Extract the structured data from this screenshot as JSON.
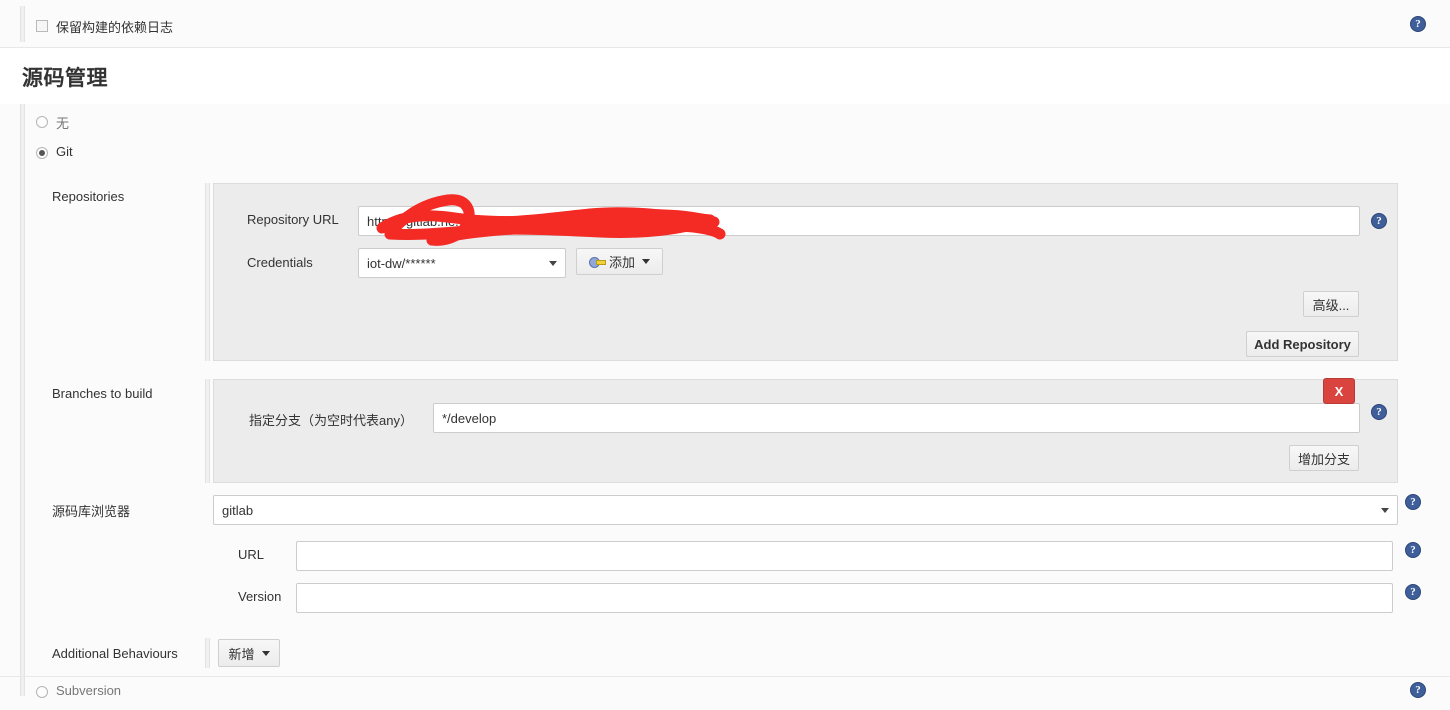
{
  "top_row": {
    "checkbox_label": "保留构建的依赖日志",
    "checked": false,
    "help_icon": "help-icon"
  },
  "section": {
    "title": "源码管理"
  },
  "scm_options": [
    {
      "label": "无",
      "selected": false
    },
    {
      "label": "Git",
      "selected": true
    },
    {
      "label": "Subversion",
      "selected": false
    }
  ],
  "repositories": {
    "section_label": "Repositories",
    "repository_url": {
      "label": "Repository URL",
      "value": "https://gitlab.he...it.c.....n/df......-dev/dw-public-ser...t",
      "redacted": true
    },
    "credentials": {
      "label": "Credentials",
      "value": "iot-dw/******",
      "add_button": "添加"
    },
    "advanced_button": "高级...",
    "add_repository_button": "Add Repository"
  },
  "branches": {
    "section_label": "Branches to build",
    "branch_spec": {
      "label": "指定分支（为空时代表any）",
      "value": "*/develop"
    },
    "delete_button": "X",
    "add_branch_button": "增加分支"
  },
  "repository_browser": {
    "label": "源码库浏览器",
    "value": "gitlab",
    "url": {
      "label": "URL",
      "value": ""
    },
    "version": {
      "label": "Version",
      "value": ""
    }
  },
  "additional_behaviours": {
    "label": "Additional Behaviours",
    "add_button": "新增"
  },
  "icons": {
    "help": "?",
    "key": "key-icon",
    "caret_down": "chevron-down-icon"
  },
  "colors": {
    "scribble_red": "#f42a25",
    "delete_red": "#d9443f",
    "help_blue": "#3f5f9a",
    "page_bg": "#fbfbfb",
    "panel_bg": "#ececec"
  }
}
